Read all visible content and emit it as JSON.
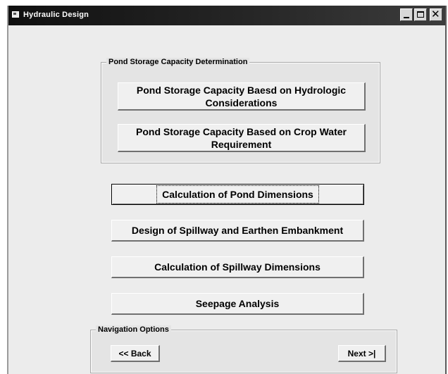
{
  "window": {
    "title": "Hydraulic Design"
  },
  "pond_storage_group": {
    "legend": "Pond Storage Capacity Determination",
    "hydrologic_button": "Pond Storage Capacity Baesd on Hydrologic Considerations",
    "crop_water_button": "Pond Storage Capacity Based on Crop Water Requirement"
  },
  "main_buttons": {
    "pond_dimensions": "Calculation of Pond Dimensions",
    "spillway_embankment": "Design of Spillway and Earthen Embankment",
    "spillway_dimensions": "Calculation of Spillway Dimensions",
    "seepage": "Seepage Analysis"
  },
  "navigation": {
    "legend": "Navigation Options",
    "back": "<< Back",
    "next": "Next >|"
  }
}
